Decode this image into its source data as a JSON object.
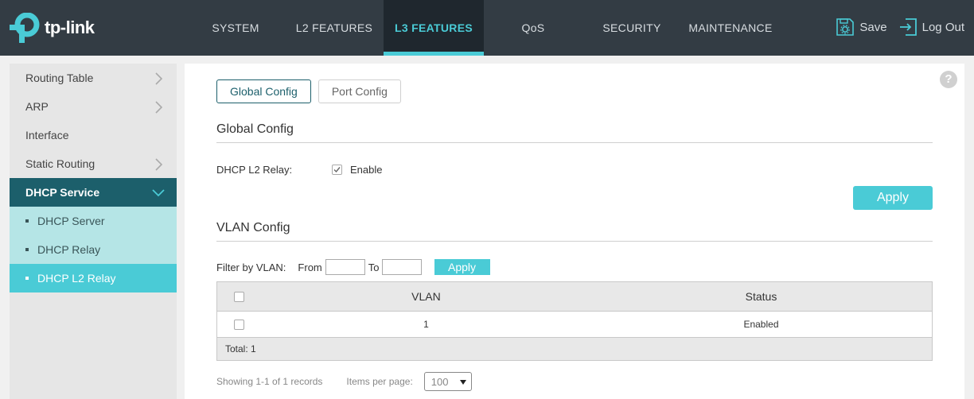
{
  "brand": {
    "name": "tp-link"
  },
  "nav": [
    {
      "label": "SYSTEM",
      "active": false
    },
    {
      "label": "L2 FEATURES",
      "active": false
    },
    {
      "label": "L3 FEATURES",
      "active": true
    },
    {
      "label": "QoS",
      "active": false
    },
    {
      "label": "SECURITY",
      "active": false
    },
    {
      "label": "MAINTENANCE",
      "active": false
    }
  ],
  "actions": {
    "save": "Save",
    "logout": "Log Out"
  },
  "sidebar": {
    "items": [
      {
        "label": "Routing Table",
        "has_children": true
      },
      {
        "label": "ARP",
        "has_children": true
      },
      {
        "label": "Interface",
        "has_children": false
      },
      {
        "label": "Static Routing",
        "has_children": true
      },
      {
        "label": "DHCP Service",
        "expanded": true
      }
    ],
    "subitems": [
      {
        "label": "DHCP Server",
        "active": false
      },
      {
        "label": "DHCP Relay",
        "active": false
      },
      {
        "label": "DHCP L2 Relay",
        "active": true
      }
    ]
  },
  "tabs": [
    {
      "label": "Global Config",
      "active": true
    },
    {
      "label": "Port Config",
      "active": false
    }
  ],
  "global_config": {
    "title": "Global Config",
    "field_label": "DHCP L2 Relay:",
    "enable_label": "Enable",
    "enabled": true,
    "apply_label": "Apply"
  },
  "vlan_config": {
    "title": "VLAN Config",
    "filter_label": "Filter by VLAN:",
    "from_label": "From",
    "to_label": "To",
    "from_value": "",
    "to_value": "",
    "apply_label": "Apply",
    "table": {
      "columns": [
        "VLAN",
        "Status"
      ],
      "rows": [
        {
          "vlan": "1",
          "status": "Enabled"
        }
      ],
      "total": "Total: 1"
    },
    "pager": {
      "showing": "Showing 1-1 of 1 records",
      "items_per_page_label": "Items per page:",
      "items_per_page": "100"
    }
  },
  "colors": {
    "topbar": "#333c44",
    "accent": "#4acbd6",
    "sidebar_open": "#1c5f6b",
    "sidebar_sub": "#b5e5e6"
  }
}
